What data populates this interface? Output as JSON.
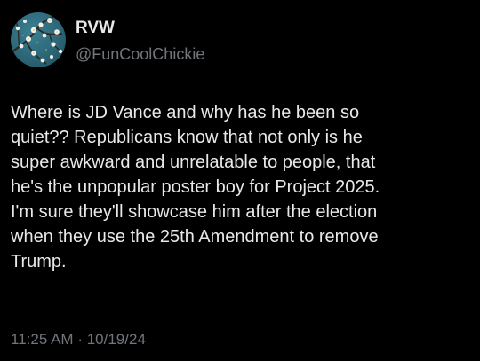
{
  "tweet": {
    "author": {
      "display_name": "RVW",
      "handle": "@FunCoolChickie",
      "avatar_icon": "almond-blossom-avatar-icon"
    },
    "text_lines": [
      "Where is JD Vance and why has he been so",
      "quiet?? Republicans know that not only is he",
      "super awkward and unrelatable to people, that",
      "he's the unpopular poster boy for Project 2025.",
      "I'm sure they'll showcase him after the election",
      "when they use the 25th Amendment to remove",
      "Trump."
    ],
    "time": "11:25 AM",
    "separator": "·",
    "date": "10/19/24"
  },
  "colors": {
    "background": "#000000",
    "primary_text": "#e7e9ea",
    "secondary_text": "#71767b",
    "avatar_base": "#2e6b7d"
  }
}
